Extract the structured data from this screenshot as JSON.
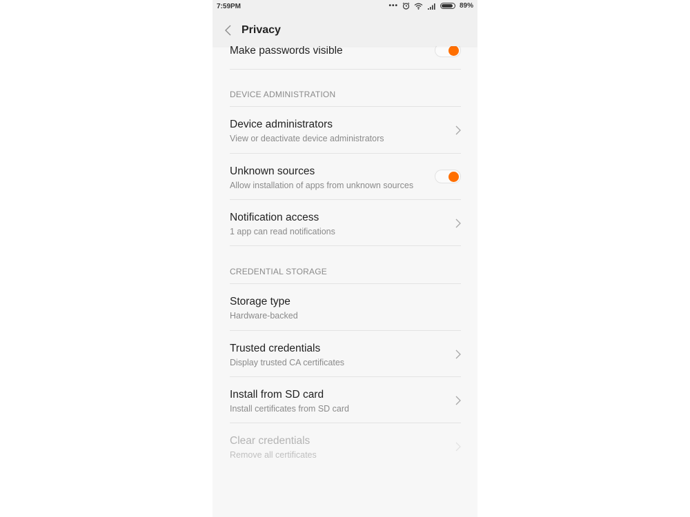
{
  "status_bar": {
    "time": "7:59PM",
    "icons": [
      "more-dots-icon",
      "alarm-icon",
      "wifi-icon",
      "signal-icon",
      "battery-icon"
    ],
    "battery_percent": "89%",
    "battery_level": 0.89
  },
  "app_bar": {
    "title": "Privacy",
    "back_icon": "chevron-left-icon"
  },
  "colors": {
    "accent": "#ff6f00",
    "background": "#f7f7f7",
    "primary_text": "#222222",
    "secondary_text": "#8a8a8a"
  },
  "items": {
    "make_passwords_visible": {
      "title": "Make passwords visible",
      "toggle_on": true
    },
    "device_admin_header": "DEVICE ADMINISTRATION",
    "device_administrators": {
      "title": "Device administrators",
      "subtitle": "View or deactivate device administrators"
    },
    "unknown_sources": {
      "title": "Unknown sources",
      "subtitle": "Allow installation of apps from unknown sources",
      "toggle_on": true
    },
    "notification_access": {
      "title": "Notification access",
      "subtitle": "1 app can read notifications"
    },
    "credential_storage_header": "CREDENTIAL STORAGE",
    "storage_type": {
      "title": "Storage type",
      "subtitle": "Hardware-backed"
    },
    "trusted_credentials": {
      "title": "Trusted credentials",
      "subtitle": "Display trusted CA certificates"
    },
    "install_from_sd": {
      "title": "Install from SD card",
      "subtitle": "Install certificates from SD card"
    },
    "clear_credentials": {
      "title": "Clear credentials",
      "subtitle": "Remove all certificates",
      "disabled": true
    }
  }
}
